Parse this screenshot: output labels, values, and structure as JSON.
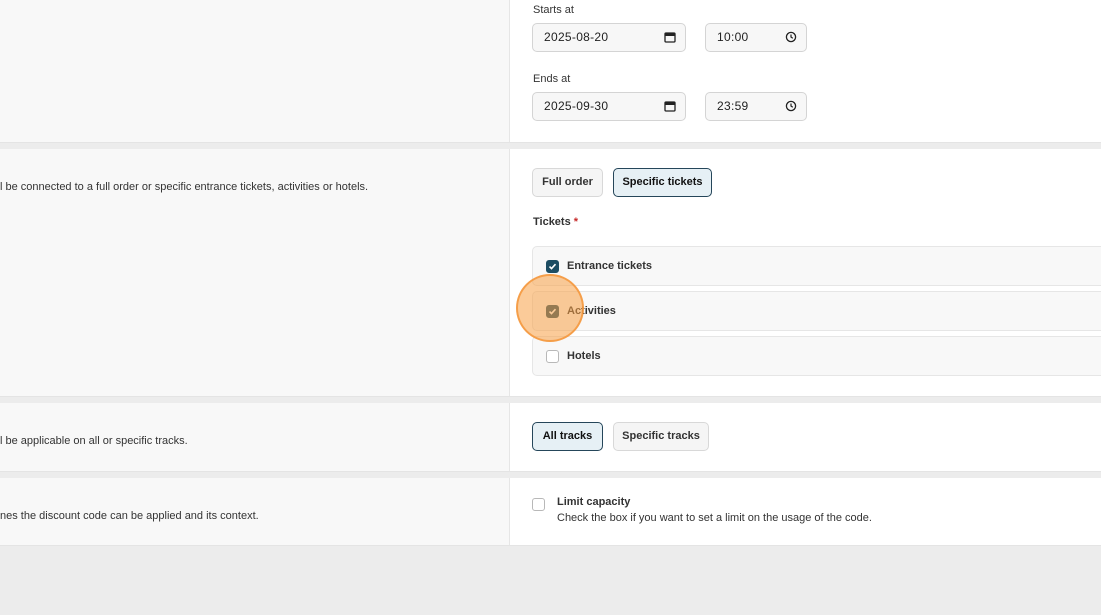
{
  "validity": {
    "starts_label": "Starts at",
    "starts_date": "2025-08-20",
    "starts_time": "10:00",
    "ends_label": "Ends at",
    "ends_date": "2025-09-30",
    "ends_time": "23:59"
  },
  "applies_to": {
    "description": "l be connected to a full order or specific entrance tickets, activities or hotels.",
    "full_order_label": "Full order",
    "specific_tickets_label": "Specific tickets",
    "selected": "Specific tickets",
    "tickets_label": "Tickets",
    "required_mark": "*",
    "options": [
      {
        "label": "Entrance tickets",
        "checked": true
      },
      {
        "label": "Activities",
        "checked": true
      },
      {
        "label": "Hotels",
        "checked": false
      }
    ]
  },
  "tracks": {
    "description": "l be applicable on all or specific tracks.",
    "all_tracks_label": "All tracks",
    "specific_tracks_label": "Specific tracks",
    "selected": "All tracks"
  },
  "usage": {
    "description": "nes the discount code can be applied and its context.",
    "limit_capacity_label": "Limit capacity",
    "limit_capacity_help": "Check the box if you want to set a limit on the usage of the code.",
    "limit_capacity_checked": false
  },
  "colors": {
    "accent": "#1d4d63",
    "active_button_bg": "#e6f0f5",
    "cursor_highlight": "#f8a046"
  }
}
